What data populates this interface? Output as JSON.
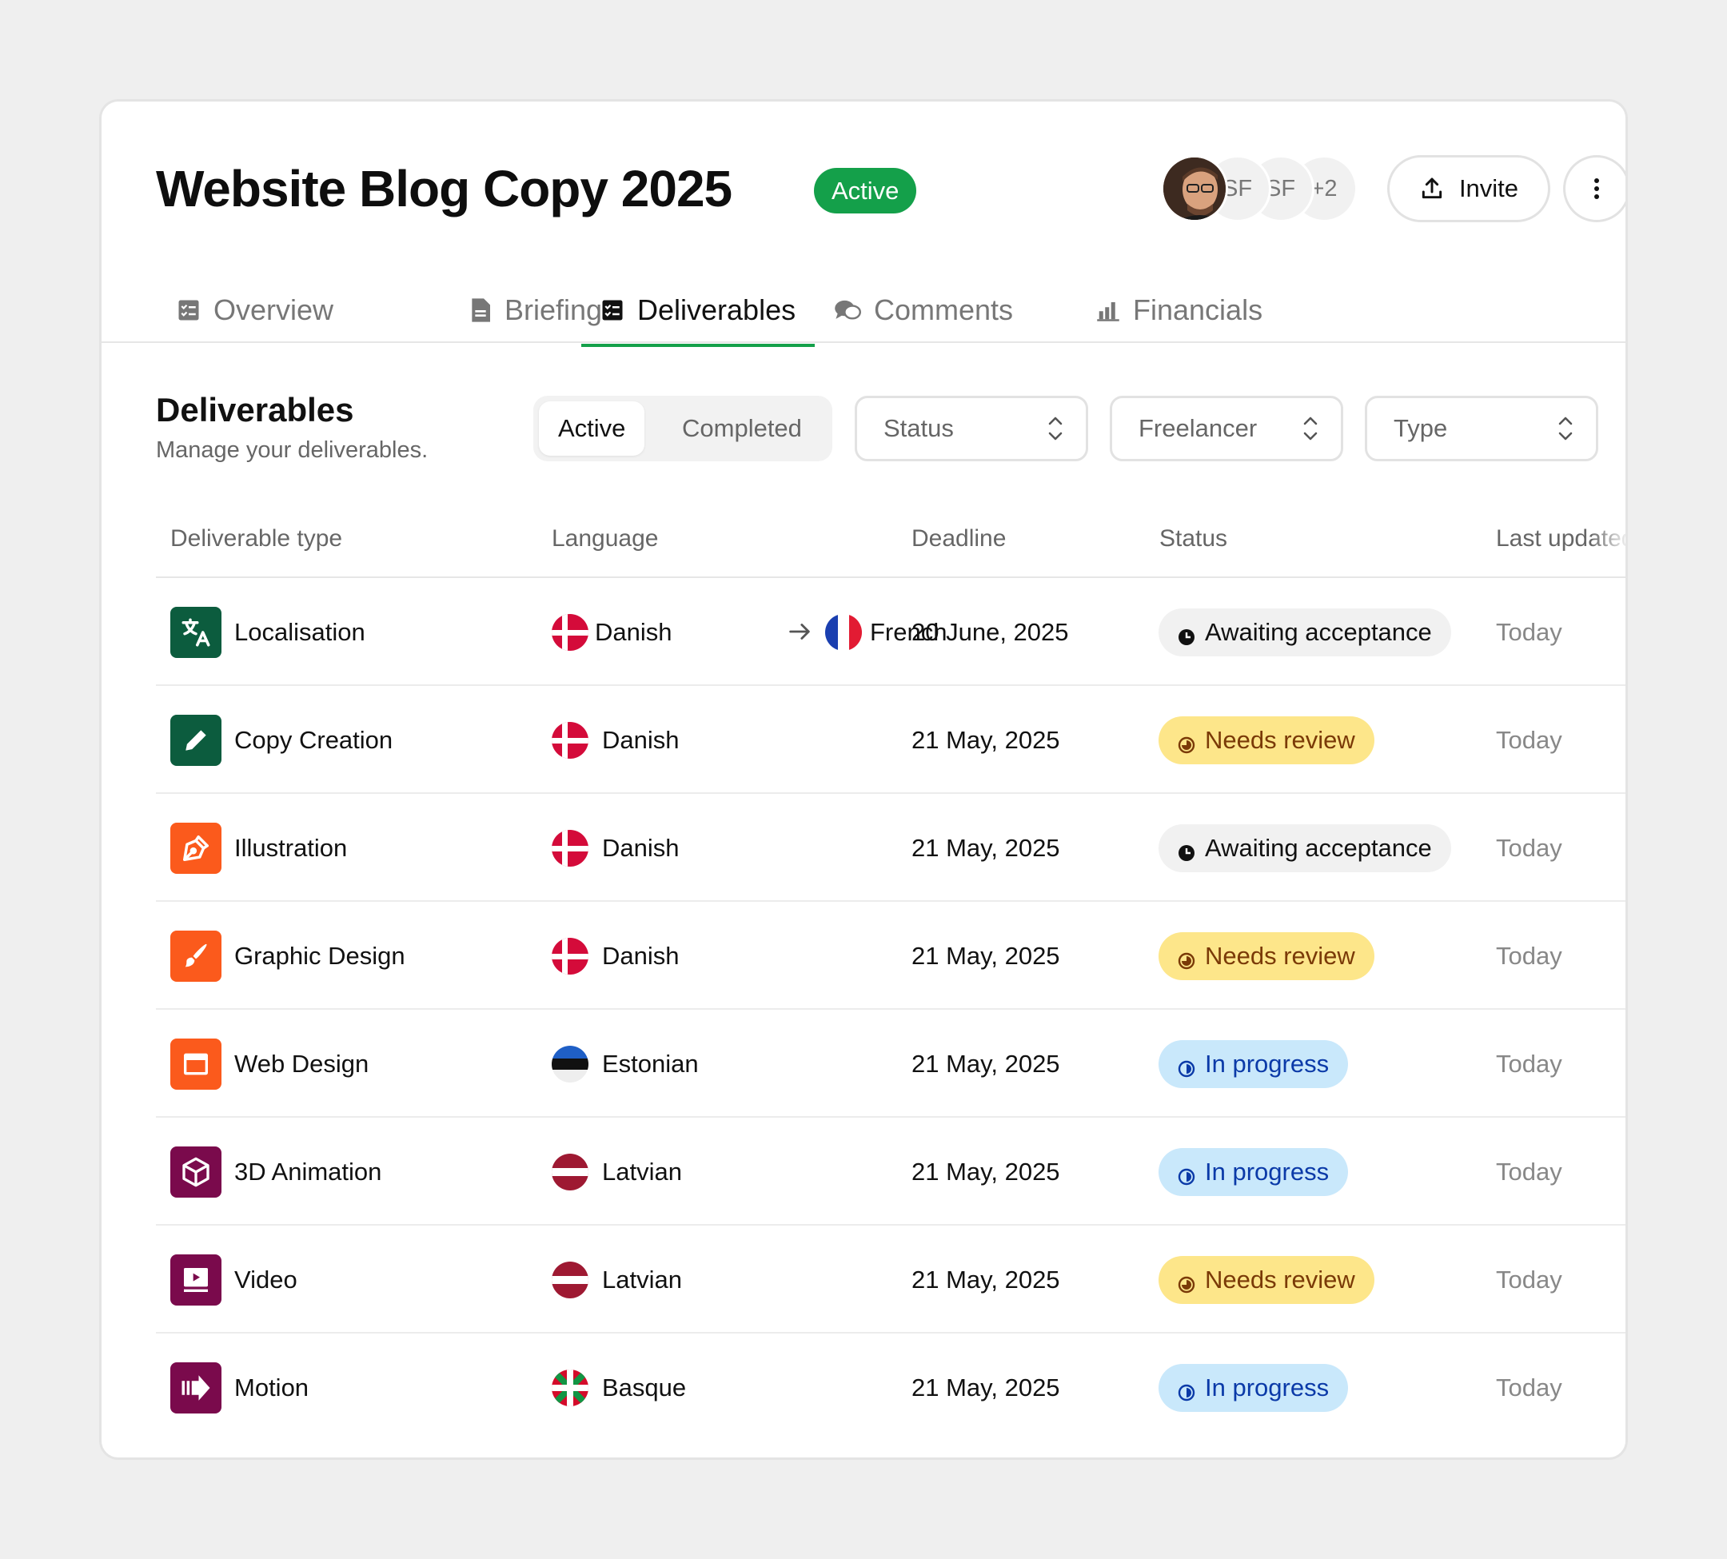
{
  "header": {
    "title": "Website Blog Copy 2025",
    "badge": "Active",
    "avatars": [
      "SF",
      "SF",
      "+2"
    ],
    "invite_label": "Invite"
  },
  "tabs": [
    {
      "label": "Overview",
      "icon": "checklist-icon"
    },
    {
      "label": "Briefing",
      "icon": "document-icon"
    },
    {
      "label": "Deliverables",
      "icon": "checklist-icon",
      "active": true
    },
    {
      "label": "Comments",
      "icon": "chat-bubbles-icon"
    },
    {
      "label": "Financials",
      "icon": "bar-chart-icon"
    }
  ],
  "section": {
    "title": "Deliverables",
    "subtitle": "Manage your deliverables.",
    "segment": [
      "Active",
      "Completed"
    ],
    "filters": [
      "Status",
      "Freelancer",
      "Type"
    ]
  },
  "table": {
    "columns": [
      "Deliverable type",
      "Language",
      "Deadline",
      "Status",
      "Last updated"
    ],
    "rows": [
      {
        "type": "Localisation",
        "icon": "translate-icon",
        "icon_color": "#0c5c3e",
        "languages": [
          "Danish",
          "French"
        ],
        "deadline": "20 June, 2025",
        "status": "Awaiting acceptance",
        "updated": "Today"
      },
      {
        "type": "Copy Creation",
        "icon": "pencil-icon",
        "icon_color": "#0c5c3e",
        "languages": [
          "Danish"
        ],
        "deadline": "21 May, 2025",
        "status": "Needs review",
        "updated": "Today"
      },
      {
        "type": "Illustration",
        "icon": "pen-nib-icon",
        "icon_color": "#fb5a1c",
        "languages": [
          "Danish"
        ],
        "deadline": "21 May, 2025",
        "status": "Awaiting acceptance",
        "updated": "Today"
      },
      {
        "type": "Graphic Design",
        "icon": "paintbrush-icon",
        "icon_color": "#fb5a1c",
        "languages": [
          "Danish"
        ],
        "deadline": "21 May, 2025",
        "status": "Needs review",
        "updated": "Today"
      },
      {
        "type": "Web Design",
        "icon": "browser-window-icon",
        "icon_color": "#fb5a1c",
        "languages": [
          "Estonian"
        ],
        "deadline": "21 May, 2025",
        "status": "In progress",
        "updated": "Today"
      },
      {
        "type": "3D Animation",
        "icon": "cube-icon",
        "icon_color": "#7a0a4c",
        "languages": [
          "Latvian"
        ],
        "deadline": "21 May, 2025",
        "status": "In progress",
        "updated": "Today"
      },
      {
        "type": "Video",
        "icon": "video-play-icon",
        "icon_color": "#7a0a4c",
        "languages": [
          "Latvian"
        ],
        "deadline": "21 May, 2025",
        "status": "Needs review",
        "updated": "Today"
      },
      {
        "type": "Motion",
        "icon": "motion-arrow-icon",
        "icon_color": "#7a0a4c",
        "languages": [
          "Basque"
        ],
        "deadline": "21 May, 2025",
        "status": "In progress",
        "updated": "Today"
      }
    ]
  },
  "colors": {
    "accent": "#14a04a",
    "awaiting_bg": "#f1f1f1",
    "review_bg": "#fde68a",
    "review_text": "#7a3a07",
    "progress_bg": "#c9e8fb",
    "progress_text": "#0b3aa8"
  }
}
